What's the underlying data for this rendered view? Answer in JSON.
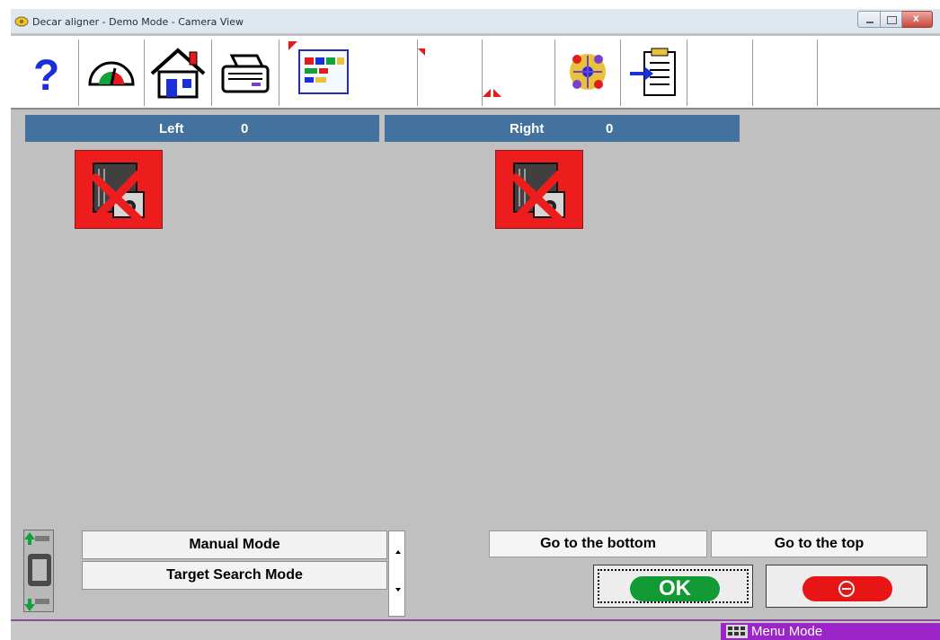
{
  "window": {
    "title": "Decar aligner - Demo Mode - Camera View"
  },
  "toolbar": {
    "buttons": [
      {
        "icon": "help-icon"
      },
      {
        "icon": "gauge-icon"
      },
      {
        "icon": "home-icon"
      },
      {
        "icon": "printer-icon"
      },
      {
        "icon": "report-icon"
      },
      {
        "icon": "blank"
      },
      {
        "icon": "blank"
      },
      {
        "icon": "targets-icon"
      },
      {
        "icon": "clipboard-import-icon"
      },
      {
        "icon": "blank"
      }
    ]
  },
  "cameras": {
    "left": {
      "label": "Left",
      "count": "0",
      "status": "camera-error-icon"
    },
    "right": {
      "label": "Right",
      "count": "0",
      "status": "camera-error-icon"
    }
  },
  "modes": {
    "items": [
      "Manual Mode",
      "Target Search Mode"
    ]
  },
  "navigation": {
    "bottom_label": "Go to the bottom",
    "top_label": "Go to the top"
  },
  "actions": {
    "ok_label": "OK"
  },
  "status": {
    "mode_label": "Menu Mode"
  },
  "colors": {
    "header": "#44729f",
    "camera_error": "#ee1d1d",
    "ok": "#129a35",
    "cancel": "#e81515",
    "status_mode": "#9b25c9"
  }
}
